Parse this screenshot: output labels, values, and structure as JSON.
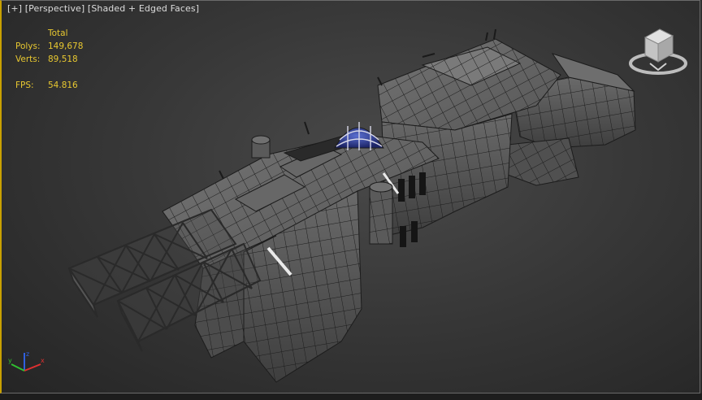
{
  "viewport": {
    "labels": [
      "[+]",
      "[Perspective]",
      "[Shaded + Edged Faces]"
    ],
    "stats": {
      "header": "Total",
      "polys_label": "Polys:",
      "polys_value": "149,678",
      "verts_label": "Verts:",
      "verts_value": "89,518",
      "fps_label": "FPS:",
      "fps_value": "54.816"
    }
  },
  "colors": {
    "stats_text": "#e8c830",
    "active_viewport_border": "#c8a000",
    "hull": "#5c5c5c",
    "wire": "#1c1c1c",
    "dome": "#2b3a8c"
  },
  "icons": {
    "viewcube": "viewcube-icon",
    "axis": "axis-tripod-icon"
  }
}
